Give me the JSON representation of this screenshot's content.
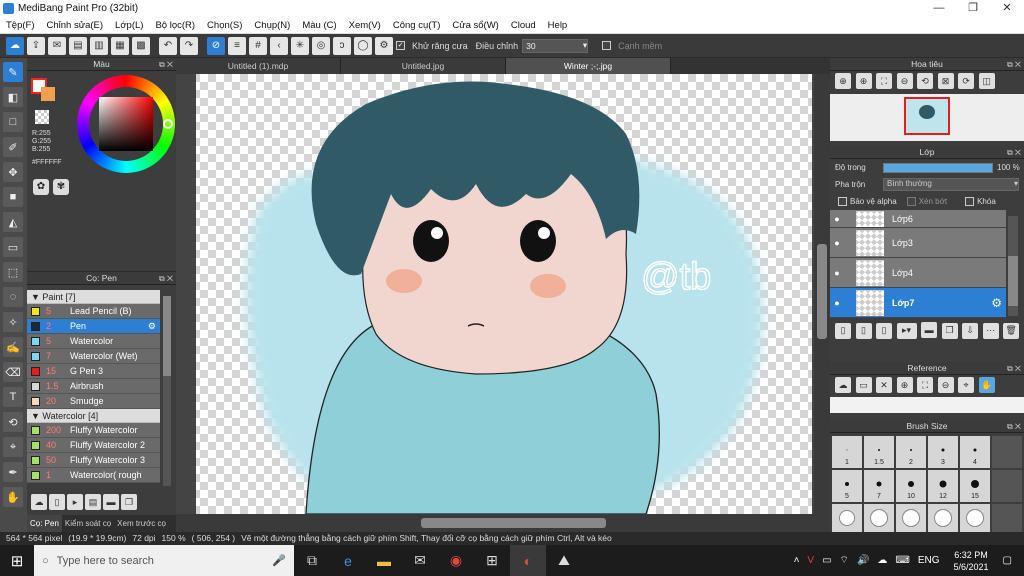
{
  "titlebar": {
    "title": "MediBang Paint Pro (32bit)",
    "minimize": "—",
    "maximize": "❐",
    "close": "✕"
  },
  "menu": [
    "Tệp(F)",
    "Chỉnh sửa(E)",
    "Lớp(L)",
    "Bộ lọc(R)",
    "Chọn(S)",
    "Chụp(N)",
    "Màu (C)",
    "Xem(V)",
    "Công cụ(T)",
    "Cửa sổ(W)",
    "Cloud",
    "Help"
  ],
  "toolbar": {
    "antialias_label": "Khử răng cưa",
    "correction_label": "Điều chỉnh",
    "correction_value": "30",
    "smooth_label": "Cạnh mềm"
  },
  "color_panel": {
    "title": "Màu",
    "r": "R:255",
    "g": "G:255",
    "b": "B:255",
    "hex": "#FFFFFF",
    "fg_color": "#ff2020",
    "bg_color": "#ffffff"
  },
  "brush_panel": {
    "title": "Cọ: Pen",
    "categories": [
      {
        "name": "Paint [7]",
        "items": [
          {
            "size": "5",
            "name": "Lead Pencil (B)",
            "color": "#f5e61c"
          },
          {
            "size": "2",
            "name": "Pen",
            "color": "#1b2a3a",
            "selected": true
          },
          {
            "size": "5",
            "name": "Watercolor",
            "color": "#7fd6f0"
          },
          {
            "size": "7",
            "name": "Watercolor (Wet)",
            "color": "#7fd6f0"
          },
          {
            "size": "15",
            "name": "G Pen 3",
            "color": "#e81c1c"
          },
          {
            "size": "1.5",
            "name": "Airbrush",
            "color": "#d8d8d8"
          },
          {
            "size": "20",
            "name": "Smudge",
            "color": "#f7d7c0"
          }
        ]
      },
      {
        "name": "Watercolor [4]",
        "items": [
          {
            "size": "200",
            "name": "Fluffy Watercolor",
            "color": "#a6e06a"
          },
          {
            "size": "40",
            "name": "Fluffy Watercolor 2",
            "color": "#a6e06a"
          },
          {
            "size": "50",
            "name": "Fluffy Watercolor 3",
            "color": "#a6e06a"
          },
          {
            "size": "1",
            "name": "Watercolor( rough",
            "color": "#a6e06a"
          }
        ]
      }
    ],
    "bottom_tabs": [
      "Cọ: Pen",
      "Kiểm soát cọ",
      "Xem trước cọ"
    ]
  },
  "doc_tabs": [
    "Untitled (1).mdp",
    "Untitled.jpg",
    "Winter ;-;.jpg"
  ],
  "canvas": {
    "watermark": "@tb"
  },
  "navigator": {
    "title": "Hoa tiêu"
  },
  "layer_panel": {
    "title": "Lớp",
    "opacity_label": "Độ trong",
    "opacity_value": "100 %",
    "blend_label": "Pha trộn",
    "blend_value": "Bình thường",
    "protect_alpha": "Bảo vệ alpha",
    "clipping": "Xén bớt",
    "lock": "Khóa",
    "layers": [
      {
        "name": "Lớp6"
      },
      {
        "name": "Lớp3"
      },
      {
        "name": "Lớp4"
      },
      {
        "name": "Lớp7",
        "selected": true
      }
    ]
  },
  "reference_panel": {
    "title": "Reference"
  },
  "brush_size_panel": {
    "title": "Brush Size",
    "sizes": [
      "1",
      "1.5",
      "2",
      "3",
      "4",
      "5",
      "7",
      "10",
      "12",
      "15",
      "",
      "",
      "",
      "",
      ""
    ]
  },
  "status": {
    "dims": "564 * 564 pixel",
    "size": "(19.9 * 19.9cm)",
    "dpi": "72 dpi",
    "zoom": "150 %",
    "coords": "( 506, 254 )",
    "hint": "Vẽ một đường thẳng bằng cách giữ phím Shift, Thay đổi cỡ cọ bằng cách giữ phím Ctrl, Alt và kéo"
  },
  "taskbar": {
    "search_placeholder": "Type here to search",
    "lang": "ENG",
    "time": "6:32 PM",
    "date": "5/6/2021"
  }
}
